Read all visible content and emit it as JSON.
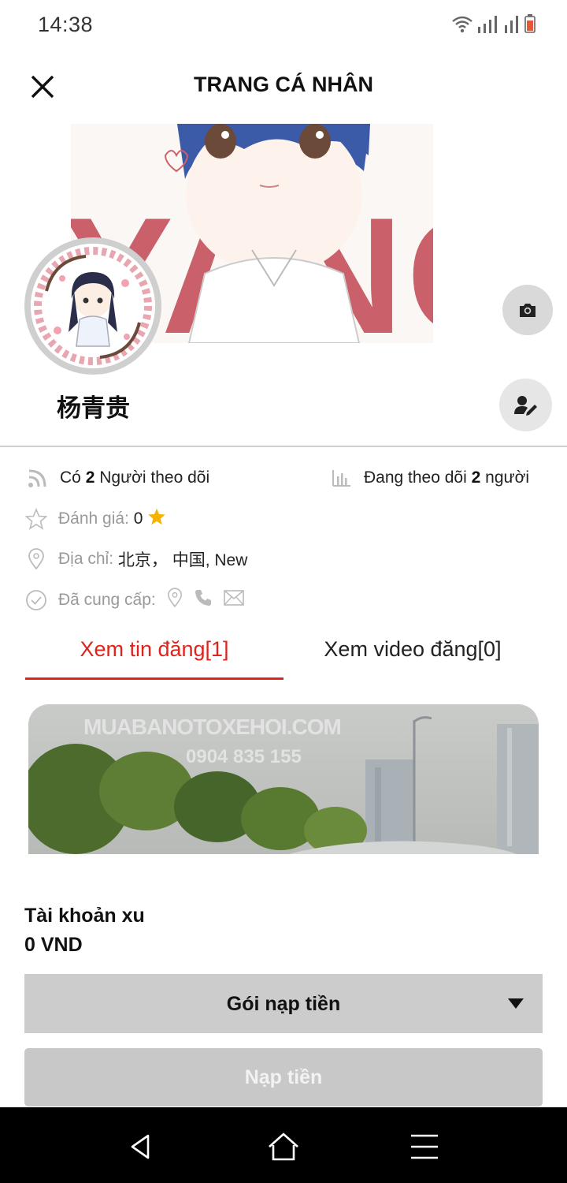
{
  "status_bar": {
    "time": "14:38",
    "icons": [
      "wifi-icon",
      "signal-icon",
      "signal-icon",
      "battery-low-icon"
    ]
  },
  "header": {
    "title": "TRANG CÁ NHÂN",
    "close_icon": "close-icon"
  },
  "cover": {
    "camera_icon": "camera-icon",
    "artwork_text": "YANG"
  },
  "profile": {
    "name": "杨青贵",
    "edit_icon": "edit-profile-icon"
  },
  "stats": {
    "followers_prefix": "Có",
    "followers_count": "2",
    "followers_suffix": "Người theo dõi",
    "following_prefix": "Đang theo dõi",
    "following_count": "2",
    "following_suffix": "người",
    "rating_label": "Đánh giá:",
    "rating_value": "0",
    "address_label": "Địa chỉ:",
    "address_value": "北京， 中国, New",
    "provided_label": "Đã cung cấp:"
  },
  "tabs": [
    {
      "label": "Xem tin đăng[1]",
      "active": true
    },
    {
      "label": "Xem video đăng[0]",
      "active": false
    }
  ],
  "post": {
    "watermark_line1": "MUABANOTOXEHOI.COM",
    "watermark_line2": "0904 835 155"
  },
  "wallet": {
    "label": "Tài khoản xu",
    "value": "0 VND"
  },
  "package_select": {
    "label": "Gói nạp tiền"
  },
  "topup_button": {
    "label": "Nạp tiền"
  },
  "colors": {
    "accent": "#e0241b",
    "star": "#f5b300",
    "button_gray": "#cccccc"
  }
}
